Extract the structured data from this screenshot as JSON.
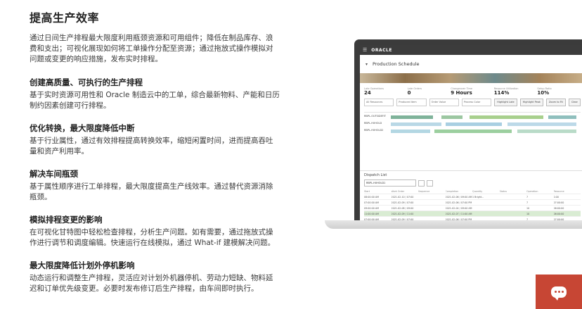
{
  "page": {
    "title": "提高生产效率",
    "intro": "通过日间生产排程最大限度利用瓶颈资源和可用组件；降低在制品库存、浪费和支出；可视化展现如何将工单操作分配至资源；通过拖放式操作模拟对问题或变更的响应措施，发布实时排程。"
  },
  "sections": [
    {
      "heading": "创建高质量、可执行的生产排程",
      "body": "基于实时资源可用性和 Oracle 制造云中的工单，综合最新物料、产能和日历制约因素创建可行排程。"
    },
    {
      "heading": "优化转换，最大限度降低中断",
      "body": "基于行业属性，通过有效排程提高转换效率，缩短闲置时间，进而提高吞吐量和资产利用率。"
    },
    {
      "heading": "解决车间瓶颈",
      "body": "基于属性顺序进行工单排程，最大限度提高生产线效率。通过替代资源消除瓶颈。"
    },
    {
      "heading": "模拟排程变更的影响",
      "body": "在可视化甘特图中轻松检查排程，分析生产问题。如有需要，通过拖放式操作进行调节和调度编辑。快速运行在线模拟，通过 What-if 建模解决问题。"
    },
    {
      "heading": "最大限度降低计划外停机影响",
      "body": "动态运行和调整生产排程，灵活应对计划外机器停机、劳动力短缺、物料延迟和订单优先级变更。必要时发布修订后生产排程，由车间即时执行。"
    }
  ],
  "screen": {
    "brand": "ORACLE",
    "menu_icon": "hamburger-icon",
    "page_title": "Production Schedule",
    "kpis": [
      {
        "label": "Late Operations",
        "value": "24"
      },
      {
        "label": "Late Orders",
        "value": "0"
      },
      {
        "label": "Changeover Time",
        "value": "9 Hours"
      },
      {
        "label": "Resource Utilization",
        "value": "114%"
      },
      {
        "label": "Setup Ratio",
        "value": "10%"
      }
    ],
    "filters": [
      "All Resources",
      "Produced Item",
      "Order Value",
      "Process Color"
    ],
    "buttons": [
      "Highlight Late",
      "Highlight Peak",
      "Zoom to Fit",
      "Clear"
    ],
    "gantt_rows": [
      "RBPL-OUTSIDEFIT",
      "RBPL-HVHOLD",
      "RBPL-HVHOLD2"
    ],
    "dispatch_title": "Dispatch List",
    "dispatch_resource": "RBPL-HVHOLD1",
    "table_header": [
      "Start",
      "Work Order",
      "Sequence",
      "Completion",
      "Quantity",
      "Status",
      "Operation",
      "Resource"
    ],
    "table_rows": [
      [
        "08:00:00 AM",
        "2021-02-10 / 07:00",
        "",
        "2021-02-06 / 09:00 AM",
        "1 Bright...",
        "",
        "7",
        "0.00"
      ],
      [
        "07:00:00 AM",
        "2021-02-09 / 07:00",
        "",
        "2021-02-06 / 07:00 PM",
        "",
        "",
        "7",
        "07:00:00"
      ],
      [
        "09:00:00 AM",
        "2021-02-08 / 09:00",
        "",
        "2021-02-04 / 09:00 AM",
        "",
        "",
        "10",
        "06:00:00"
      ],
      [
        "11:00:00 AM",
        "2021-02-09 / 11:00",
        "",
        "2021-02-07 / 11:00 AM",
        "",
        "",
        "10",
        "06:00:00"
      ],
      [
        "07:00:00 AM",
        "2021-02-09 / 07:00",
        "",
        "2021-02-06 / 07:00 PM",
        "",
        "",
        "7",
        "07:00:00"
      ],
      [
        "07:00:00 AM",
        "2021-02-09 / 07:00",
        "",
        "2021-02-07 / 07:00 PM",
        "",
        "",
        "7",
        "07:00:00"
      ],
      [
        "07:00:00 AM",
        "2021-02-09 / 07:00",
        "",
        "2021-02-07 / 07:00 PM",
        "",
        "",
        "7",
        "07:00:00"
      ],
      [
        "09:00:00 AM",
        "2021-02-09 / 09:00",
        "",
        "2021-02-08 / 09:00 AM",
        "",
        "",
        "7",
        "06:00:00"
      ]
    ]
  },
  "chat": {
    "icon": "chat-icon",
    "color": "#c74634"
  }
}
